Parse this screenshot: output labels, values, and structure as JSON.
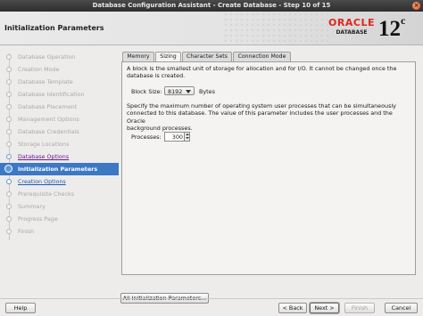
{
  "window": {
    "title": "Database Configuration Assistant - Create Database - Step 10 of 15",
    "close_glyph": "×"
  },
  "header": {
    "page_title": "Initialization Parameters",
    "logo_word": "ORACLE",
    "logo_sub": "DATABASE",
    "version_number": "12",
    "version_letter": "c"
  },
  "sidebar": {
    "steps": [
      {
        "label": "Database Operation",
        "state": "disabled"
      },
      {
        "label": "Creation Mode",
        "state": "disabled"
      },
      {
        "label": "Database Template",
        "state": "disabled"
      },
      {
        "label": "Database Identification",
        "state": "disabled"
      },
      {
        "label": "Database Placement",
        "state": "disabled"
      },
      {
        "label": "Management Options",
        "state": "disabled"
      },
      {
        "label": "Database Credentials",
        "state": "disabled"
      },
      {
        "label": "Storage Locations",
        "state": "disabled"
      },
      {
        "label": "Database Options",
        "state": "done"
      },
      {
        "label": "Initialization Parameters",
        "state": "current"
      },
      {
        "label": "Creation Options",
        "state": "next"
      },
      {
        "label": "Prerequisite Checks",
        "state": "disabled"
      },
      {
        "label": "Summary",
        "state": "disabled"
      },
      {
        "label": "Progress Page",
        "state": "disabled"
      },
      {
        "label": "Finish",
        "state": "disabled"
      }
    ]
  },
  "tabs": [
    {
      "label": "Memory",
      "active": false
    },
    {
      "label": "Sizing",
      "active": true
    },
    {
      "label": "Character Sets",
      "active": false
    },
    {
      "label": "Connection Mode",
      "active": false
    }
  ],
  "sizing": {
    "block_desc_line1": "A block is the smallest unit of storage for allocation and for I/O. It cannot be changed once the",
    "block_desc_line2": "database is created.",
    "block_size_label": "Block Size:",
    "block_size_value": "8192",
    "block_size_units": "Bytes",
    "proc_desc_line1": "Specify the maximum number of operating system user processes that can be simultaneously",
    "proc_desc_line2": "connected to this database. The value of this parameter includes the user processes and the Oracle",
    "proc_desc_line3": "background processes.",
    "processes_label": "Processes:",
    "processes_value": "300"
  },
  "buttons": {
    "all_params": "All Initialization Parameters...",
    "help": "Help",
    "back": "< Back",
    "next": "Next >",
    "finish": "Finish",
    "cancel": "Cancel"
  }
}
